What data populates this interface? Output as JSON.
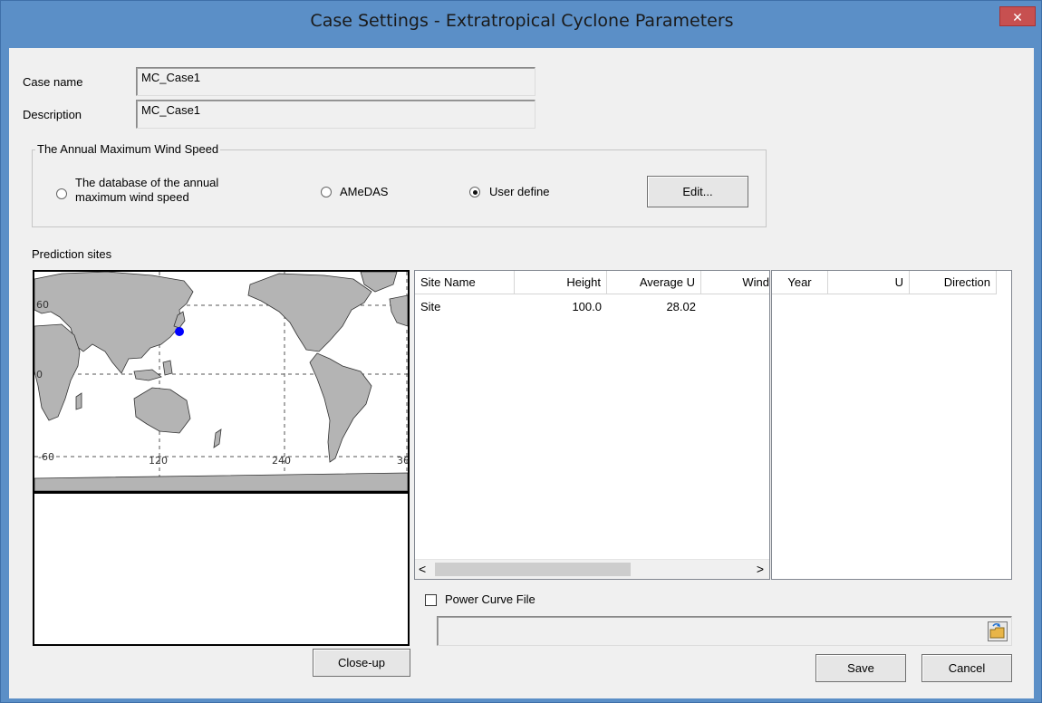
{
  "window": {
    "title": "Case Settings - Extratropical Cyclone Parameters",
    "close_glyph": "✕"
  },
  "form": {
    "case_name_label": "Case name",
    "case_name_value": "MC_Case1",
    "description_label": "Description",
    "description_value": "MC_Case1"
  },
  "wind_speed_group": {
    "title": "The Annual Maximum Wind Speed",
    "options": [
      {
        "label_line1": "The database of the annual",
        "label_line2": "maximum wind speed",
        "selected": false
      },
      {
        "label": "AMeDAS",
        "selected": false
      },
      {
        "label": "User define",
        "selected": true
      }
    ],
    "edit_button": "Edit..."
  },
  "prediction_sites": {
    "label": "Prediction sites",
    "map_labels": {
      "lat_top": "60",
      "lat_mid": "0",
      "lat_bottom": "-60",
      "lon_120": "120",
      "lon_240": "240",
      "lon_360": "36"
    },
    "closeup_button": "Close-up"
  },
  "sites_table": {
    "columns": [
      "Site Name",
      "Height",
      "Average U",
      "Wind"
    ],
    "rows": [
      {
        "site_name": "Site",
        "height": "100.0",
        "average_u": "28.02"
      }
    ],
    "scroll_left": "<",
    "scroll_right": ">"
  },
  "year_table": {
    "columns": [
      "Year",
      "U",
      "Direction"
    ]
  },
  "power_curve": {
    "checkbox_label": "Power Curve File",
    "checked": false,
    "file_path": ""
  },
  "footer": {
    "save_button": "Save",
    "cancel_button": "Cancel"
  },
  "colors": {
    "title_bar": "#5b8fc7",
    "close_button": "#c75050",
    "dialog_bg": "#f0f0f0",
    "site_marker": "#0000ff",
    "land": "#b4b4b4"
  }
}
